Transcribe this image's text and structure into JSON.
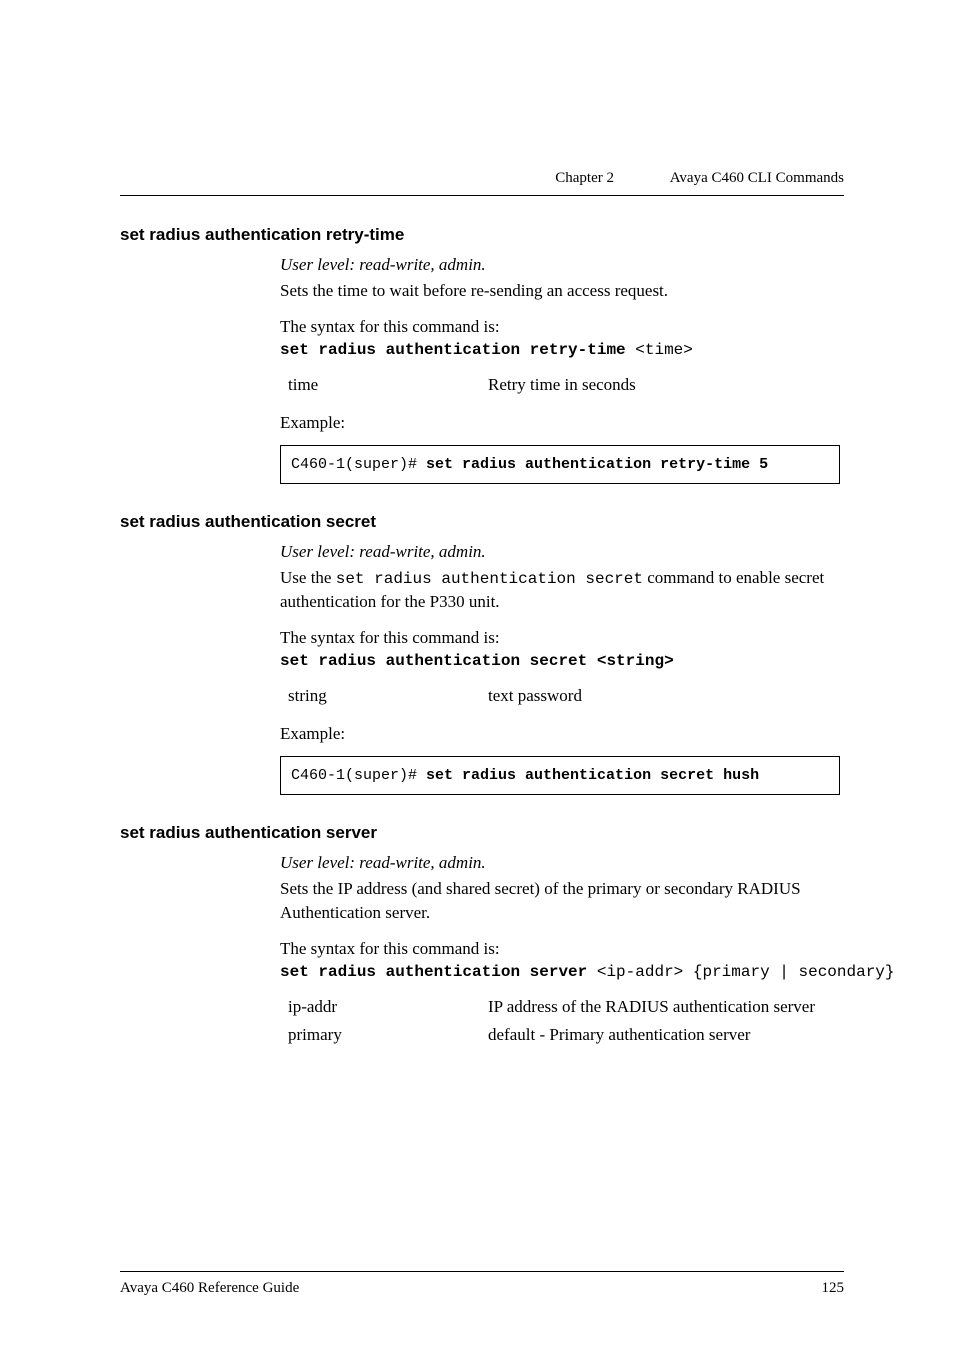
{
  "header": {
    "chapter": "Chapter 2",
    "title": "Avaya C460 CLI Commands"
  },
  "section1": {
    "heading": "set radius authentication retry-time",
    "userlevel": "User level: read-write, admin.",
    "desc": "Sets the time to wait before re-sending an access request.",
    "syntax_label": "The syntax for this command is:",
    "syntax_cmd": "set radius authentication retry-time",
    "syntax_arg": " <time>",
    "param_key": "time",
    "param_val": "Retry time in seconds",
    "example_label": "Example:",
    "example_prompt": "C460-1(super)# ",
    "example_cmd": "set radius authentication retry-time 5"
  },
  "section2": {
    "heading": "set radius authentication secret",
    "userlevel": "User level: read-write, admin.",
    "desc_pre": "Use the ",
    "desc_code": "set radius authentication secret",
    "desc_post": " command to enable secret authentication for the P330 unit.",
    "syntax_label": "The syntax for this command is:",
    "syntax_cmd": "set radius authentication secret <string>",
    "param_key": "string",
    "param_val": "text password",
    "example_label": "Example:",
    "example_prompt": "C460-1(super)# ",
    "example_cmd": "set radius authentication secret hush"
  },
  "section3": {
    "heading": "set radius authentication server",
    "userlevel": "User level: read-write, admin.",
    "desc": "Sets the IP address (and shared secret) of the primary or secondary RADIUS Authentication server.",
    "syntax_label": "The syntax for this command is:",
    "syntax_cmd": "set radius authentication server",
    "syntax_arg": " <ip-addr> {primary | secondary}",
    "param1_key": "ip-addr",
    "param1_val": "IP address of the RADIUS authentication server",
    "param2_key": "primary",
    "param2_val": "default - Primary authentication server"
  },
  "footer": {
    "left": "Avaya C460 Reference Guide",
    "right": "125"
  }
}
